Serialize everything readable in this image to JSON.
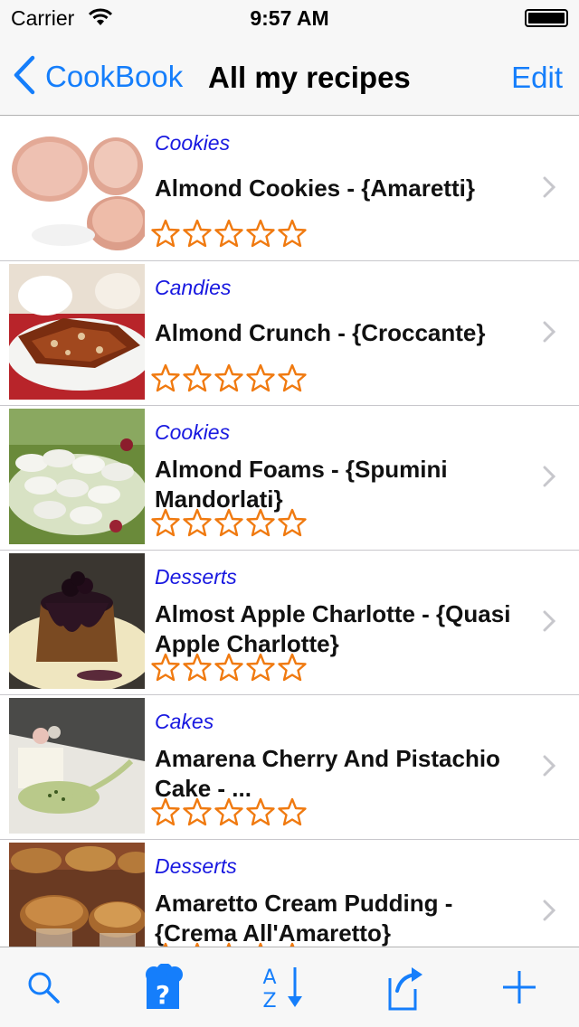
{
  "status_bar": {
    "carrier": "Carrier",
    "time": "9:57 AM"
  },
  "nav": {
    "back_label": "CookBook",
    "title": "All my recipes",
    "edit_label": "Edit"
  },
  "recipes": [
    {
      "category": "Cookies",
      "title": "Almond Cookies - {Amaretti}",
      "rating": 0
    },
    {
      "category": "Candies",
      "title": "Almond Crunch - {Croccante}",
      "rating": 0
    },
    {
      "category": "Cookies",
      "title": "Almond Foams - {Spumini Mandorlati}",
      "rating": 0
    },
    {
      "category": "Desserts",
      "title": "Almost Apple Charlotte - {Quasi Apple Charlotte}",
      "rating": 0
    },
    {
      "category": "Cakes",
      "title": "Amarena Cherry And Pistachio Cake - ...",
      "rating": 0
    },
    {
      "category": "Desserts",
      "title": "Amaretto Cream Pudding - {Crema All'Amaretto}",
      "rating": 0
    }
  ],
  "toolbar": {
    "icons": [
      "search-icon",
      "chef-help-icon",
      "sort-az-icon",
      "share-icon",
      "add-icon"
    ]
  },
  "colors": {
    "accent": "#157efb",
    "category": "#1818e0",
    "star": "#f07a10"
  }
}
